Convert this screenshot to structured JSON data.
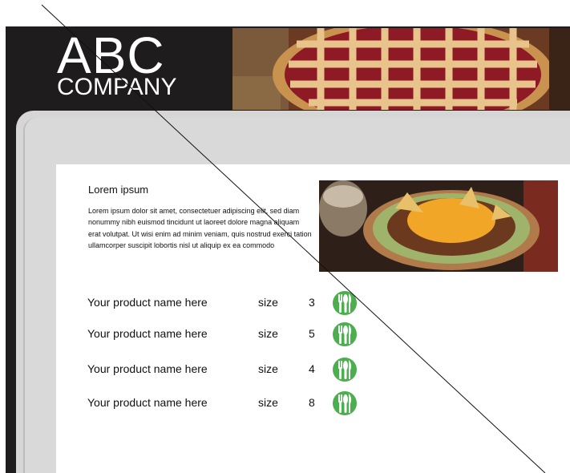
{
  "logo": {
    "line1": "ABC",
    "line2": "COMPANY"
  },
  "intro": {
    "title": "Lorem ipsum",
    "body": "Lorem ipsum dolor sit amet, consectetuer adipiscing elit, sed diam nonummy nibh euismod tincidunt ut laoreet dolore magna aliquam erat volutpat. Ut wisi enim ad minim veniam, quis nostrud exerci tation ullamcorper suscipit lobortis nisl ut aliquip ex ea commodo"
  },
  "products": [
    {
      "name": "Your product name here",
      "size_label": "size",
      "qty": "3",
      "icon": "utensils-icon"
    },
    {
      "name": "Your product name here",
      "size_label": "size",
      "qty": "5",
      "icon": "utensils-icon"
    },
    {
      "name": "Your product name here",
      "size_label": "size",
      "qty": "4",
      "icon": "utensils-icon"
    },
    {
      "name": "Your product name here",
      "size_label": "size",
      "qty": "8",
      "icon": "utensils-icon"
    }
  ],
  "colors": {
    "frame": "#1e1c1c",
    "panel": "#d6d6d6",
    "icon_green": "#4cae4f"
  }
}
